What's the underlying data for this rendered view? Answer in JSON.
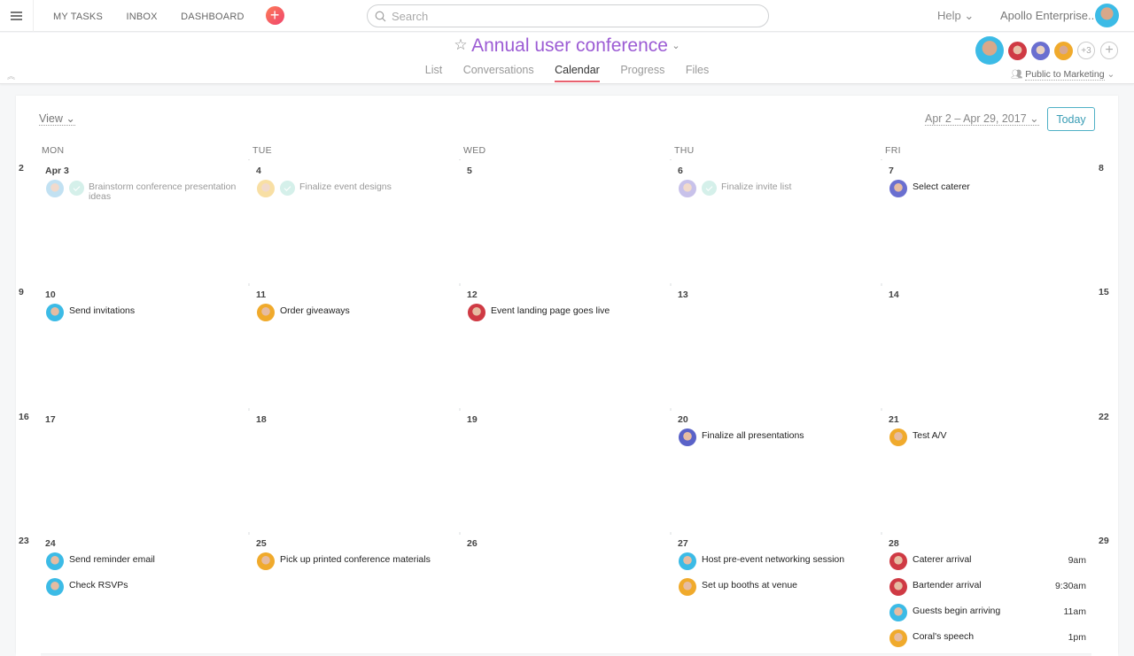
{
  "topbar": {
    "nav": [
      "MY TASKS",
      "INBOX",
      "DASHBOARD"
    ],
    "search_placeholder": "Search",
    "help_label": "Help ⌄",
    "org_label": "Apollo Enterprise..",
    "add_icon": "plus-icon",
    "accent": "#f0466e"
  },
  "project": {
    "title": "Annual user conference",
    "tabs": [
      "List",
      "Conversations",
      "Calendar",
      "Progress",
      "Files"
    ],
    "active_tab": "Calendar",
    "extra_members_label": "+3",
    "privacy_label": "Public to Marketing",
    "title_color": "#9c5cd4"
  },
  "calendar": {
    "view_label": "View",
    "range_label": "Apr 2 – Apr 29, 2017",
    "today_label": "Today",
    "weekdays": [
      "MON",
      "TUE",
      "WED",
      "THU",
      "FRI"
    ],
    "weeks": [
      {
        "sun": "2",
        "sat": "8",
        "days": [
          {
            "label": "Apr 3",
            "tasks": [
              {
                "title": "Brainstorm conference presentation ideas",
                "done": true,
                "avatar": "#8fc8e8"
              }
            ]
          },
          {
            "label": "4",
            "tasks": [
              {
                "title": "Finalize event designs",
                "done": true,
                "avatar": "#f3c55a"
              }
            ]
          },
          {
            "label": "5",
            "tasks": []
          },
          {
            "label": "6",
            "tasks": [
              {
                "title": "Finalize invite list",
                "done": true,
                "avatar": "#9b8fd8"
              }
            ]
          },
          {
            "label": "7",
            "tasks": [
              {
                "title": "Select caterer",
                "done": false,
                "avatar": "#6a6fd0"
              }
            ]
          }
        ]
      },
      {
        "sun": "9",
        "sat": "15",
        "days": [
          {
            "label": "10",
            "tasks": [
              {
                "title": "Send invitations",
                "done": false,
                "avatar": "#3cbbe6"
              }
            ]
          },
          {
            "label": "11",
            "tasks": [
              {
                "title": "Order giveaways",
                "done": false,
                "avatar": "#f0aa2c"
              }
            ]
          },
          {
            "label": "12",
            "tasks": [
              {
                "title": "Event landing page goes live",
                "done": false,
                "avatar": "#cf3a44"
              }
            ]
          },
          {
            "label": "13",
            "tasks": []
          },
          {
            "label": "14",
            "tasks": []
          }
        ]
      },
      {
        "sun": "16",
        "sat": "22",
        "days": [
          {
            "label": "17",
            "tasks": []
          },
          {
            "label": "18",
            "tasks": []
          },
          {
            "label": "19",
            "tasks": []
          },
          {
            "label": "20",
            "tasks": [
              {
                "title": "Finalize all presentations",
                "done": false,
                "avatar": "#5a62c8"
              }
            ]
          },
          {
            "label": "21",
            "tasks": [
              {
                "title": "Test A/V",
                "done": false,
                "avatar": "#f0aa2c"
              }
            ]
          }
        ]
      },
      {
        "sun": "23",
        "sat": "29",
        "days": [
          {
            "label": "24",
            "tasks": [
              {
                "title": "Send reminder email",
                "done": false,
                "avatar": "#3cbbe6"
              },
              {
                "title": "Check RSVPs",
                "done": false,
                "avatar": "#3cbbe6"
              }
            ]
          },
          {
            "label": "25",
            "tasks": [
              {
                "title": "Pick up printed conference materials",
                "done": false,
                "avatar": "#f0aa2c"
              }
            ]
          },
          {
            "label": "26",
            "tasks": []
          },
          {
            "label": "27",
            "tasks": [
              {
                "title": "Host pre-event networking session",
                "done": false,
                "avatar": "#3cbbe6"
              },
              {
                "title": "Set up booths at venue",
                "done": false,
                "avatar": "#f0aa2c"
              }
            ]
          },
          {
            "label": "28",
            "tasks": [
              {
                "title": "Caterer arrival",
                "done": false,
                "avatar": "#cf3a44",
                "time": "9am"
              },
              {
                "title": "Bartender arrival",
                "done": false,
                "avatar": "#cf3a44",
                "time": "9:30am"
              },
              {
                "title": "Guests begin arriving",
                "done": false,
                "avatar": "#3cbbe6",
                "time": "11am"
              },
              {
                "title": "Coral's speech",
                "done": false,
                "avatar": "#f0aa2c",
                "time": "1pm"
              }
            ]
          }
        ]
      }
    ]
  },
  "members": [
    "#3cbbe6",
    "#cf3a44",
    "#6a6fd0",
    "#f0aa2c"
  ]
}
